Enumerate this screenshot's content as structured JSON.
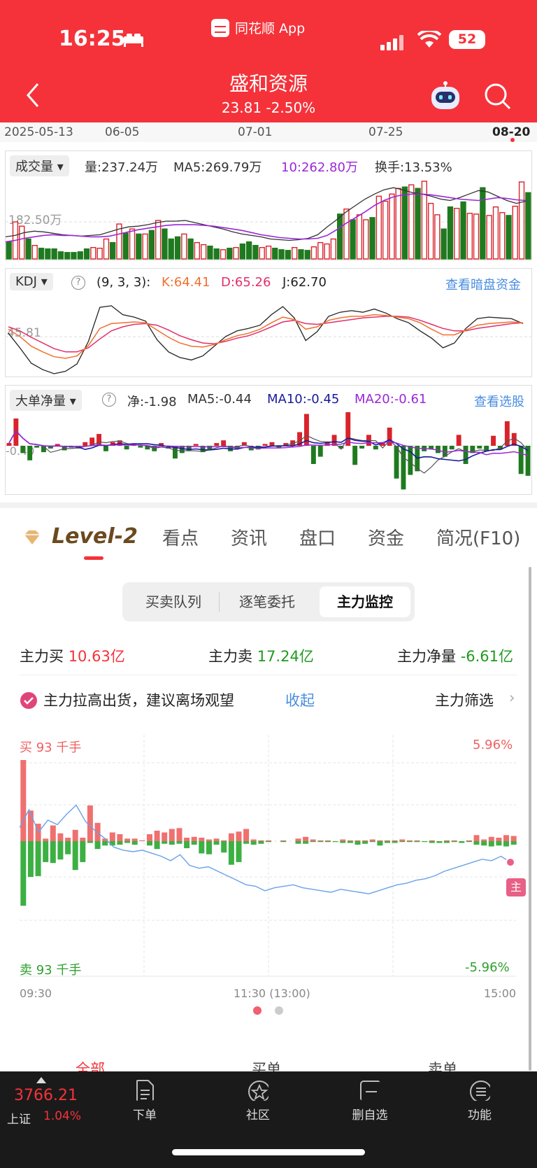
{
  "status": {
    "time": "16:25",
    "app": "同花顺 App",
    "battery": "52"
  },
  "header": {
    "title": "盛和资源",
    "price": "23.81 -2.50%"
  },
  "dates": [
    "2025-05-13",
    "06-05",
    "07-01",
    "07-25",
    "08-20"
  ],
  "volume_panel": {
    "tag": "成交量",
    "vol": "量:237.24万",
    "ma5": "MA5:269.79万",
    "ma10": "10:262.80万",
    "turnover": "换手:13.53%",
    "level": "182.50万",
    "bars": [
      24,
      52,
      46,
      28,
      19,
      15,
      14,
      14,
      10,
      9,
      9,
      10,
      14,
      16,
      15,
      28,
      23,
      49,
      36,
      42,
      35,
      35,
      40,
      54,
      42,
      28,
      31,
      35,
      28,
      23,
      20,
      18,
      14,
      13,
      15,
      16,
      21,
      24,
      19,
      16,
      18,
      15,
      13,
      12,
      16,
      13,
      12,
      17,
      23,
      21,
      28,
      63,
      70,
      55,
      62,
      55,
      58,
      88,
      81,
      91,
      99,
      101,
      104,
      99,
      109,
      78,
      62,
      42,
      73,
      71,
      80,
      64,
      63,
      100,
      61,
      73,
      65,
      61,
      74,
      108,
      93
    ],
    "colors": "GRRGRGGGGGGGGRRRGRGRGRGRGGGRGRRGGRGRGGGRRGGGRGGRRRRGRGRRGRRRRGRGRRRGGRGRRGRRRGRRG",
    "ma5_line": [
      31,
      33,
      37,
      39,
      38,
      36,
      34,
      33,
      32,
      33,
      34,
      38,
      42,
      45,
      46,
      48,
      51,
      53,
      53,
      54,
      51,
      48,
      45,
      42,
      38,
      35,
      33,
      31,
      28,
      27,
      26,
      27,
      29,
      34,
      45,
      55,
      66,
      75,
      84,
      91,
      97,
      100,
      97,
      93,
      91,
      88,
      84,
      82,
      86,
      91,
      96,
      94,
      88,
      82,
      78,
      81
    ],
    "ma10_line": [
      24,
      26,
      29,
      31,
      33,
      34,
      33,
      33,
      32,
      31,
      31,
      32,
      35,
      38,
      41,
      43,
      45,
      47,
      48,
      48,
      48,
      47,
      46,
      44,
      42,
      40,
      37,
      34,
      32,
      30,
      29,
      28,
      28,
      29,
      33,
      41,
      50,
      58,
      66,
      75,
      82,
      87,
      90,
      91,
      91,
      90,
      88,
      86,
      84,
      83,
      82,
      84,
      86,
      85,
      83,
      82
    ]
  },
  "kdj_panel": {
    "tag": "KDJ",
    "params": "(9, 3, 3):",
    "k": "K:64.41",
    "d": "D:65.26",
    "j": "J:62.70",
    "link": "查看暗盘资金",
    "level": "45.81",
    "k_line": [
      55,
      46,
      34,
      27,
      21,
      19,
      22,
      35,
      56,
      62,
      63,
      64,
      63,
      54,
      45,
      38,
      34,
      33,
      36,
      42,
      47,
      50,
      55,
      63,
      70,
      67,
      55,
      58,
      66,
      69,
      71,
      71,
      73,
      72,
      70,
      68,
      63,
      55,
      48,
      48,
      54,
      60,
      62,
      63,
      64,
      63
    ],
    "d_line": [
      58,
      53,
      45,
      38,
      31,
      27,
      27,
      32,
      43,
      53,
      58,
      61,
      62,
      60,
      54,
      47,
      42,
      38,
      37,
      40,
      44,
      47,
      52,
      58,
      64,
      66,
      62,
      61,
      63,
      65,
      67,
      69,
      70,
      71,
      71,
      70,
      66,
      61,
      56,
      53,
      53,
      56,
      58,
      60,
      62,
      63
    ],
    "j_line": [
      50,
      32,
      13,
      5,
      0,
      3,
      12,
      40,
      82,
      84,
      73,
      70,
      65,
      42,
      27,
      20,
      17,
      22,
      34,
      46,
      53,
      56,
      60,
      73,
      83,
      69,
      41,
      52,
      71,
      76,
      78,
      76,
      80,
      75,
      68,
      63,
      53,
      44,
      32,
      38,
      56,
      68,
      70,
      69,
      68,
      62
    ]
  },
  "bigorder_panel": {
    "tag": "大单净量",
    "net": "净:-1.98",
    "ma5": "MA5:-0.44",
    "ma10": "MA10:-0.45",
    "ma20": "MA20:-0.61",
    "link": "查看选股",
    "level": "-0.40",
    "bars": [
      0.3,
      3.0,
      -0.8,
      -1.6,
      -0.2,
      -0.7,
      -0.3,
      0.2,
      -0.5,
      -0.2,
      -0.3,
      0.4,
      0.9,
      1.3,
      -0.6,
      0.4,
      0.6,
      -0.4,
      0.2,
      -0.2,
      -0.4,
      -0.6,
      0.3,
      -0.3,
      -1.4,
      -0.8,
      -0.5,
      0.2,
      -0.7,
      -0.4,
      0.3,
      0.6,
      -0.6,
      -0.3,
      0.4,
      -0.5,
      -0.4,
      0.2,
      0.4,
      -0.2,
      0.3,
      0.6,
      1.5,
      3.5,
      -2.0,
      -1.2,
      0.4,
      1.2,
      -0.3,
      4.4,
      -2.1,
      -0.3,
      1.2,
      -0.4,
      0.4,
      2.0,
      -3.6,
      -4.8,
      -3.2,
      -2.8,
      -0.6,
      -0.4,
      -0.8,
      -1.2,
      -0.4,
      1.2,
      -2.0,
      -0.8,
      -0.3,
      -0.6,
      1.1,
      -0.4,
      2.7,
      1.4,
      -3.1,
      -3.3
    ]
  },
  "tabs": [
    "Level-2",
    "看点",
    "资讯",
    "盘口",
    "资金",
    "简况(F10)"
  ],
  "segments": [
    "买卖队列",
    "逐笔委托",
    "主力监控"
  ],
  "summary": {
    "buy_label": "主力买",
    "buy_val": "10.63亿",
    "sell_label": "主力卖",
    "sell_val": "17.24亿",
    "net_label": "主力净量",
    "net_val": "-6.61亿"
  },
  "alert": {
    "text": "主力拉高出货，建议离场观望",
    "collapse": "收起",
    "filter": "主力筛选"
  },
  "monitor_chart": {
    "buy_axis": "买 93 千手",
    "sell_axis": "卖 93 千手",
    "top_pct": "5.96%",
    "bottom_pct": "-5.96%",
    "marker": "主",
    "times": [
      "09:30",
      "11:30 (13:00)",
      "15:00"
    ],
    "buy": [
      93,
      35,
      20,
      3,
      18,
      9,
      4,
      13,
      4,
      41,
      21,
      3,
      10,
      8,
      3,
      3,
      1,
      8,
      12,
      10,
      14,
      15,
      4,
      5,
      4,
      2,
      3,
      1,
      9,
      11,
      14,
      2,
      1,
      1,
      0,
      1,
      0,
      3,
      5,
      2,
      1,
      1,
      0,
      2,
      1,
      1,
      1,
      2,
      1,
      1,
      1,
      2,
      1,
      1,
      0,
      1,
      0,
      1,
      1,
      0,
      1,
      7,
      2,
      5,
      4,
      7,
      6
    ],
    "sell": [
      74,
      41,
      40,
      24,
      25,
      21,
      15,
      33,
      24,
      2,
      9,
      5,
      5,
      4,
      2,
      4,
      0,
      5,
      9,
      3,
      4,
      3,
      8,
      4,
      14,
      15,
      4,
      13,
      27,
      24,
      3,
      4,
      3,
      1,
      0,
      1,
      0,
      3,
      3,
      1,
      1,
      1,
      1,
      2,
      2,
      4,
      3,
      1,
      5,
      2,
      2,
      1,
      1,
      1,
      1,
      2,
      2,
      2,
      1,
      2,
      1,
      4,
      5,
      6,
      5,
      6,
      4
    ],
    "line": [
      0.9,
      2.1,
      0.6,
      1.4,
      1.1,
      1.8,
      2.4,
      1.3,
      0.7,
      0.2,
      -0.4,
      -0.6,
      -0.7,
      -0.6,
      -0.8,
      -1.0,
      -1.3,
      -0.9,
      -1.6,
      -1.8,
      -1.7,
      -2.0,
      -2.3,
      -2.6,
      -2.9,
      -3.0,
      -3.3,
      -3.1,
      -3.0,
      -2.9,
      -3.1,
      -3.2,
      -3.3,
      -3.4,
      -3.2,
      -3.3,
      -3.4,
      -3.5,
      -3.3,
      -3.1,
      -2.9,
      -2.8,
      -2.6,
      -2.5,
      -2.3,
      -2.0,
      -1.8,
      -1.6,
      -1.4,
      -1.2,
      -1.3,
      -1.0,
      -1.4
    ]
  },
  "pager": [
    "dot-1",
    "dot-2"
  ],
  "list_tabs": [
    "全部",
    "买单",
    "卖单"
  ],
  "bottom_bar": {
    "index_val": "3766.21",
    "index_name": "上证",
    "index_chg": "1.04%",
    "items": [
      "下单",
      "社区",
      "删自选",
      "功能"
    ]
  },
  "colors": {
    "red": "#f5323a",
    "green": "#1f7a1f",
    "blue": "#4a8de0",
    "purple": "#9b27d8",
    "navy": "#1a1a9a"
  }
}
